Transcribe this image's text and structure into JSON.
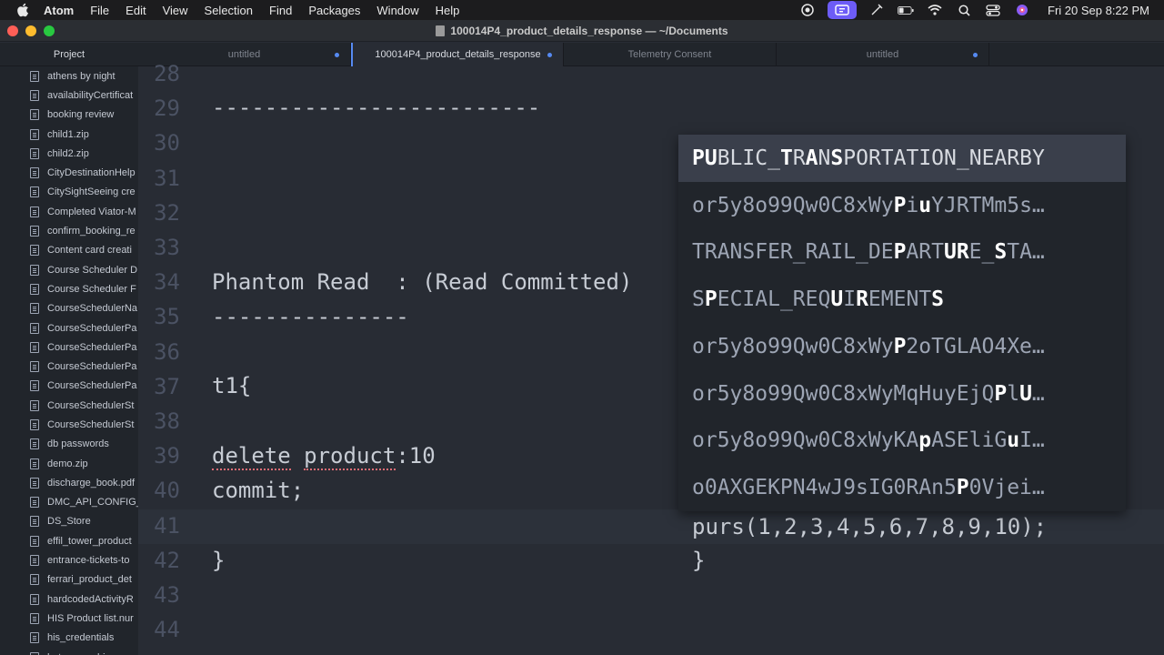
{
  "menubar": {
    "app_name": "Atom",
    "items": [
      "File",
      "Edit",
      "View",
      "Selection",
      "Find",
      "Packages",
      "Window",
      "Help"
    ],
    "clock": "Fri 20 Sep  8:22 PM"
  },
  "window": {
    "title": "100014P4_product_details_response — ~/Documents"
  },
  "tree": {
    "header": "Project",
    "items": [
      "athens by night",
      "availabilityCertificat",
      "booking review",
      "child1.zip",
      "child2.zip",
      "CityDestinationHelp",
      "CitySightSeeing cre",
      "Completed Viator-M",
      "confirm_booking_re",
      "Content card creati",
      "Course Scheduler D",
      "Course Scheduler F",
      "CourseSchedulerNa",
      "CourseSchedulerPa",
      "CourseSchedulerPa",
      "CourseSchedulerPa",
      "CourseSchedulerPa",
      "CourseSchedulerSt",
      "CourseSchedulerSt",
      "db passwords",
      "demo.zip",
      "discharge_book.pdf",
      "DMC_API_CONFIG_",
      "DS_Store",
      "effil_tower_product",
      "entrance-tickets-to",
      "ferrari_product_det",
      "hardcodedActivityR",
      "HIS Product list.nur",
      "his_credentials",
      "hotpos_arabie"
    ]
  },
  "tabs": [
    {
      "label": "untitled",
      "modified": true
    },
    {
      "label": "100014P4_product_details_response",
      "modified": true
    },
    {
      "label": "Telemetry Consent",
      "modified": false
    },
    {
      "label": "untitled",
      "modified": true
    }
  ],
  "editor": {
    "line_numbers": [
      "28",
      "29",
      "30",
      "31",
      "32",
      "33",
      "34",
      "35",
      "36",
      "37",
      "38",
      "39",
      "40",
      "41",
      "42",
      "43",
      "44"
    ],
    "lines": {
      "l29": "-------------------------",
      "l34": "Phantom Read  : (Read Committed)",
      "l35": "---------------",
      "l37": "t1{",
      "l39a": "delete",
      "l39b": "product",
      "l39c": ":10",
      "l40": "commit;",
      "l41_right": "purs(1,2,3,4,5,6,7,8,9,10);",
      "l42_left": "}",
      "l42_right": "}"
    }
  },
  "autocomplete": {
    "items": [
      [
        [
          "b",
          "PU"
        ],
        [
          "",
          "BLIC_"
        ],
        [
          "b",
          "T"
        ],
        [
          "",
          "R"
        ],
        [
          "b",
          "A"
        ],
        [
          "",
          "N"
        ],
        [
          "b",
          "S"
        ],
        [
          "",
          "PORTATION_NEARBY"
        ]
      ],
      [
        [
          "",
          "or5y8o99Qw0C8xWy"
        ],
        [
          "b",
          "P"
        ],
        [
          "",
          "i"
        ],
        [
          "b",
          "u"
        ],
        [
          "",
          "YJRTMm5s…"
        ]
      ],
      [
        [
          "",
          "TRANSFER_RAIL_DE"
        ],
        [
          "b",
          "P"
        ],
        [
          "",
          "ART"
        ],
        [
          "b",
          "UR"
        ],
        [
          "",
          "E_"
        ],
        [
          "b",
          "S"
        ],
        [
          "",
          "TA…"
        ]
      ],
      [
        [
          "",
          "S"
        ],
        [
          "b",
          "P"
        ],
        [
          "",
          "ECIAL_REQ"
        ],
        [
          "b",
          "U"
        ],
        [
          "",
          "I"
        ],
        [
          "b",
          "R"
        ],
        [
          "",
          "EMENT"
        ],
        [
          "b",
          "S"
        ]
      ],
      [
        [
          "",
          "or5y8o99Qw0C8xWy"
        ],
        [
          "b",
          "P"
        ],
        [
          "",
          "2oTGLAO4Xe…"
        ]
      ],
      [
        [
          "",
          "or5y8o99Qw0C8xWyMqHuyEjQ"
        ],
        [
          "b",
          "P"
        ],
        [
          "",
          "l"
        ],
        [
          "b",
          "U"
        ],
        [
          "",
          "…"
        ]
      ],
      [
        [
          "",
          "or5y8o99Qw0C8xWyKA"
        ],
        [
          "b",
          "p"
        ],
        [
          "",
          "ASEliG"
        ],
        [
          "b",
          "u"
        ],
        [
          "",
          "I…"
        ]
      ],
      [
        [
          "",
          "o0AXGEKPN4wJ9sIG0RAn5"
        ],
        [
          "b",
          "P"
        ],
        [
          "",
          "0Vjei…"
        ]
      ]
    ]
  },
  "colors": {
    "editor_bg": "#282c34",
    "panel_bg": "#21252b",
    "accent": "#568af2",
    "error_underline": "#e06c75"
  }
}
